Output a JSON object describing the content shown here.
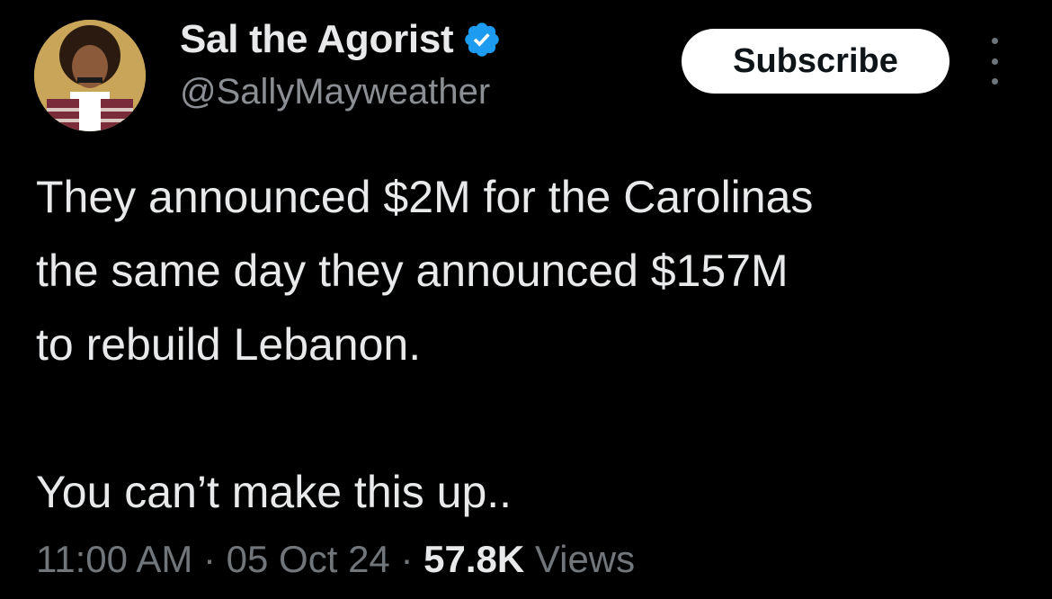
{
  "author": {
    "display_name": "Sal the Agorist",
    "handle": "@SallyMayweather",
    "verified_icon": "verified-badge-icon",
    "avatar_icon": "avatar"
  },
  "actions": {
    "subscribe_label": "Subscribe",
    "more_icon": "more-options-icon"
  },
  "tweet": {
    "lines": [
      "They announced $2M for the Carolinas",
      "the same day they announced $157M",
      "to rebuild Lebanon.",
      "You can’t make this up.."
    ]
  },
  "meta": {
    "time": "11:00 AM",
    "separator": " · ",
    "date": "05 Oct 24",
    "views_count": "57.8K",
    "views_label": "Views"
  },
  "colors": {
    "background": "#000000",
    "text_primary": "#e7e9ea",
    "text_secondary": "#71767b",
    "verified_blue": "#1d9bf0",
    "button_bg": "#ffffff"
  }
}
